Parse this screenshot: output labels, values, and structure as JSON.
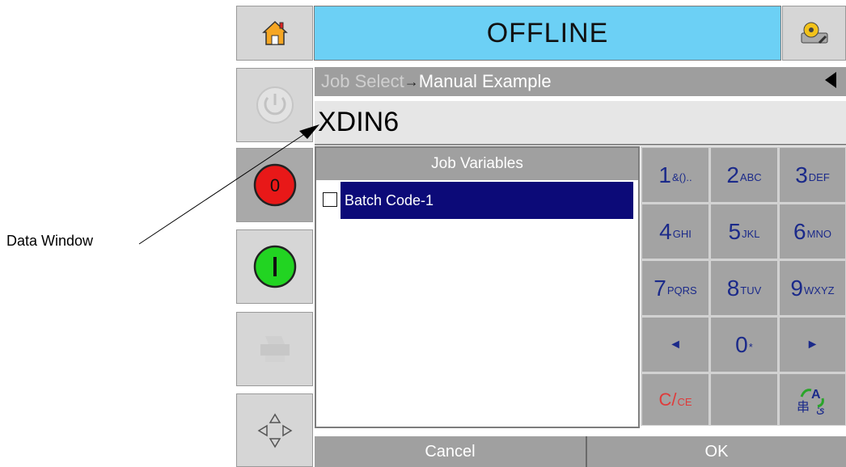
{
  "header": {
    "status": "OFFLINE"
  },
  "breadcrumb": {
    "parent": "Job Select",
    "separator": "→",
    "current": "Manual Example"
  },
  "data_window": {
    "value": "XDIN6"
  },
  "variables": {
    "title": "Job Variables",
    "items": [
      {
        "label": "Batch Code-1",
        "checked": false,
        "selected": true
      }
    ]
  },
  "keypad": {
    "keys": [
      {
        "main": "1",
        "sub": "&().."
      },
      {
        "main": "2",
        "sub": "ABC"
      },
      {
        "main": "3",
        "sub": "DEF"
      },
      {
        "main": "4",
        "sub": "GHI"
      },
      {
        "main": "5",
        "sub": "JKL"
      },
      {
        "main": "6",
        "sub": "MNO"
      },
      {
        "main": "7",
        "sub": "PQRS"
      },
      {
        "main": "8",
        "sub": "TUV"
      },
      {
        "main": "9",
        "sub": "WXYZ"
      },
      {
        "main": "◄",
        "sub": ""
      },
      {
        "main": "0",
        "sub": "*"
      },
      {
        "main": "►",
        "sub": ""
      }
    ],
    "clear": {
      "main": "C/",
      "sub": "CE"
    }
  },
  "footer": {
    "cancel": "Cancel",
    "ok": "OK"
  },
  "annotation": {
    "label": "Data Window"
  },
  "colors": {
    "header_bg": "#6cd0f5",
    "selection_bg": "#0c0a78",
    "stop_red": "#e81818",
    "start_green": "#22d422",
    "key_text": "#1b2a8a"
  }
}
